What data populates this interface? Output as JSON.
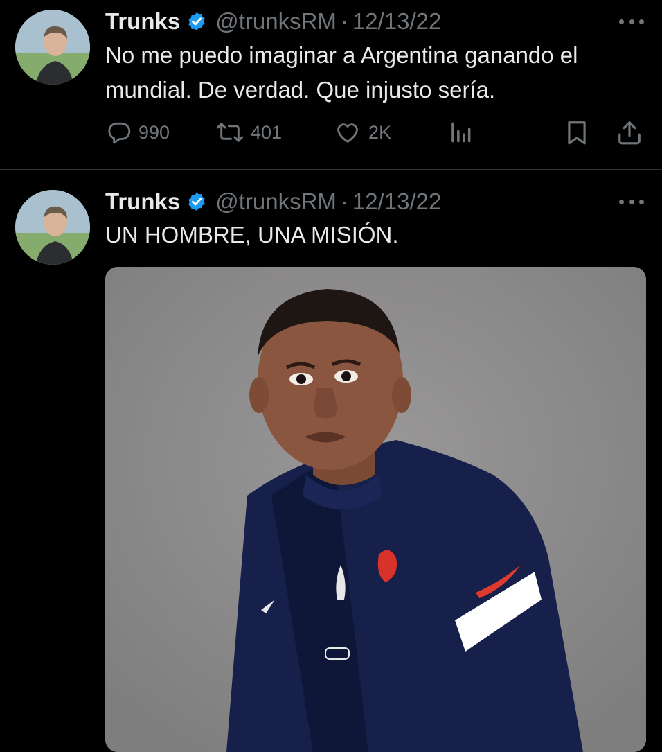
{
  "tweets": [
    {
      "author_name": "Trunks",
      "handle": "@trunksRM",
      "separator": "·",
      "date": "12/13/22",
      "text": "No me puedo imaginar a Argentina ganando el mundial. De verdad. Que injusto sería.",
      "stats": {
        "replies": "990",
        "retweets": "401",
        "likes": "2K"
      }
    },
    {
      "author_name": "Trunks",
      "handle": "@trunksRM",
      "separator": "·",
      "date": "12/13/22",
      "text": "UN HOMBRE, UNA MISIÓN."
    }
  ],
  "icons": {
    "verified": "verified-badge-icon",
    "reply": "reply-icon",
    "retweet": "retweet-icon",
    "like": "heart-icon",
    "views": "views-icon",
    "bookmark": "bookmark-icon",
    "share": "share-icon",
    "more": "more-icon"
  },
  "colors": {
    "background": "#000000",
    "text": "#e7e9ea",
    "secondary_text": "#71767b",
    "verified_blue": "#1d9bf0",
    "divider": "#2f3336"
  }
}
